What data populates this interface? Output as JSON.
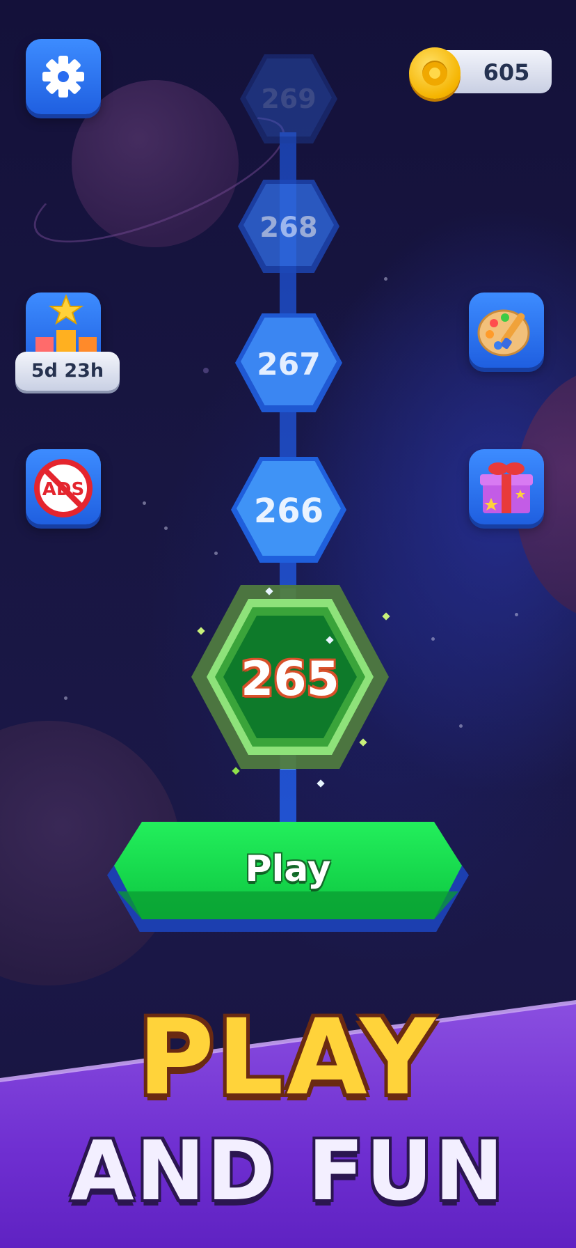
{
  "header": {
    "settings_icon": "gear-icon",
    "coins": {
      "icon": "coin-icon",
      "value": "605"
    }
  },
  "side_buttons": {
    "leaderboard": {
      "icon": "trophy-podium-icon",
      "timer": "5d 23h"
    },
    "no_ads": {
      "icon": "no-ads-icon",
      "label": "ADS"
    },
    "theme": {
      "icon": "paint-palette-icon"
    },
    "gift": {
      "icon": "gift-box-icon"
    }
  },
  "level_path": {
    "levels": [
      {
        "number": "269",
        "state": "locked"
      },
      {
        "number": "268",
        "state": "locked"
      },
      {
        "number": "267",
        "state": "locked"
      },
      {
        "number": "266",
        "state": "locked"
      }
    ],
    "current_level": "265"
  },
  "play_button": {
    "label": "Play"
  },
  "promo": {
    "line1": "PLAY",
    "line2": "AND FUN"
  },
  "colors": {
    "background": "#15123a",
    "accent_green": "#12d64a",
    "accent_blue": "#2f6ae0",
    "banner_purple": "#7a39d8",
    "promo_yellow": "#ffd33a"
  }
}
